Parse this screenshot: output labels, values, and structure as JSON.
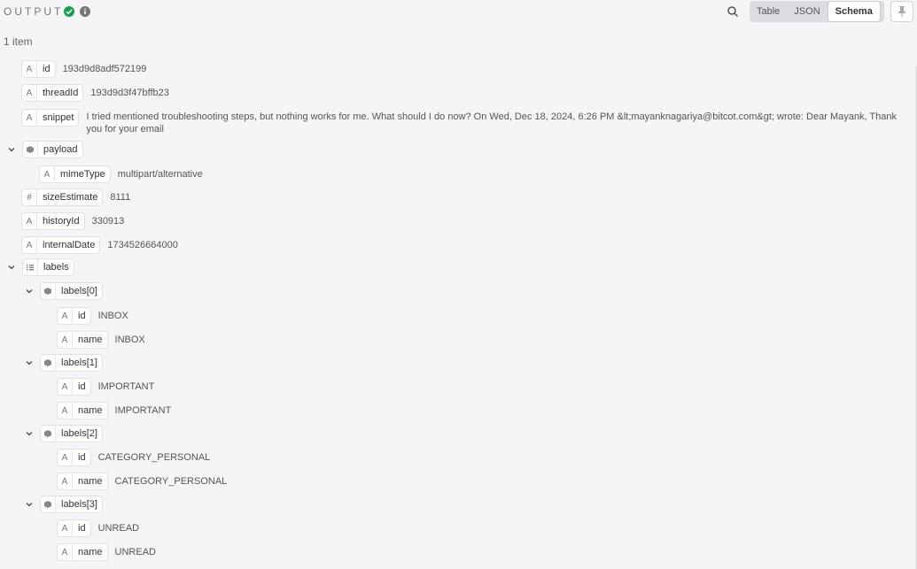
{
  "header": {
    "title": "OUTPUT",
    "tabs": [
      "Table",
      "JSON",
      "Schema"
    ],
    "active_tab": "Schema"
  },
  "summary": {
    "count": "1 item"
  },
  "fields": {
    "id": {
      "key": "id",
      "value": "193d9d8adf572199"
    },
    "threadId": {
      "key": "threadId",
      "value": "193d9d3f47bffb23"
    },
    "snippet": {
      "key": "snippet",
      "value": "I tried mentioned troubleshooting steps, but nothing works for me. What should I do now? On Wed, Dec 18, 2024, 6:26 PM &lt;mayanknagariya@bitcot.com&gt; wrote: Dear Mayank, Thank you for your email"
    },
    "payload": {
      "key": "payload",
      "mimeType": {
        "key": "mimeType",
        "value": "multipart/alternative"
      }
    },
    "sizeEstimate": {
      "key": "sizeEstimate",
      "value": "8111"
    },
    "historyId": {
      "key": "historyId",
      "value": "330913"
    },
    "internalDate": {
      "key": "internalDate",
      "value": "1734526664000"
    },
    "labels": {
      "key": "labels",
      "items": [
        {
          "key": "labels[0]",
          "id": "INBOX",
          "name": "INBOX"
        },
        {
          "key": "labels[1]",
          "id": "IMPORTANT",
          "name": "IMPORTANT"
        },
        {
          "key": "labels[2]",
          "id": "CATEGORY_PERSONAL",
          "name": "CATEGORY_PERSONAL"
        },
        {
          "key": "labels[3]",
          "id": "UNREAD",
          "name": "UNREAD"
        }
      ],
      "child_keys": {
        "id": "id",
        "name": "name"
      }
    }
  },
  "type_icons": {
    "string": "A",
    "number": "#"
  }
}
